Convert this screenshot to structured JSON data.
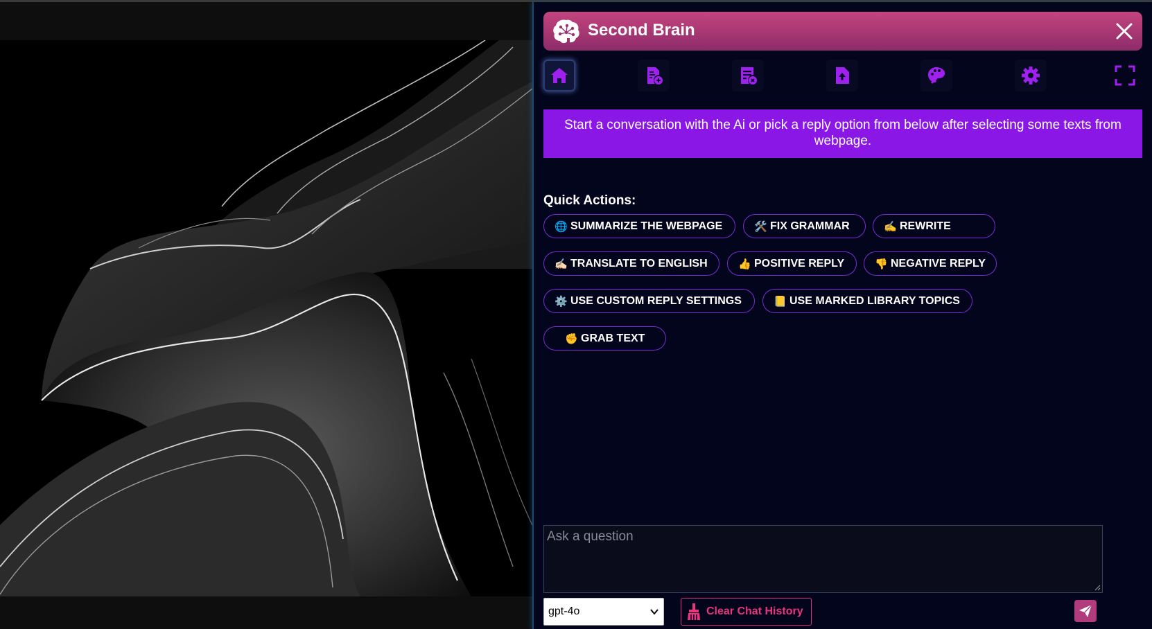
{
  "app": {
    "title": "Second Brain"
  },
  "nav": [
    "home-icon",
    "add-note-icon",
    "library-icon",
    "upload-icon",
    "palette-icon",
    "gear-icon",
    "fullscreen-icon"
  ],
  "banner": {
    "text": "Start a conversation with the Ai or pick a reply option from below after selecting some texts from webpage."
  },
  "quick_actions": {
    "title": "Quick Actions:",
    "buttons": [
      {
        "emoji": "🌐",
        "label": "SUMMARIZE THE WEBPAGE"
      },
      {
        "emoji": "🛠️",
        "label": "FIX GRAMMAR"
      },
      {
        "emoji": "✍️",
        "label": "REWRITE"
      },
      {
        "emoji": "✍🏻",
        "label": "TRANSLATE TO ENGLISH"
      },
      {
        "emoji": "👍",
        "label": "POSITIVE REPLY"
      },
      {
        "emoji": "👎",
        "label": "NEGATIVE REPLY"
      },
      {
        "emoji": "⚙️",
        "label": "USE CUSTOM REPLY SETTINGS"
      },
      {
        "emoji": "📒",
        "label": "USE MARKED LIBRARY TOPICS"
      },
      {
        "emoji": "✊",
        "label": "GRAB TEXT"
      }
    ]
  },
  "input": {
    "placeholder": "Ask a question"
  },
  "footer": {
    "model": "gpt-4o",
    "clear_label": "Clear Chat History"
  },
  "colors": {
    "accent": "#8a17e6",
    "header_start": "#c4447e",
    "header_end": "#8d2c6a",
    "clear": "#e8357d",
    "icon": "#a020f0"
  }
}
